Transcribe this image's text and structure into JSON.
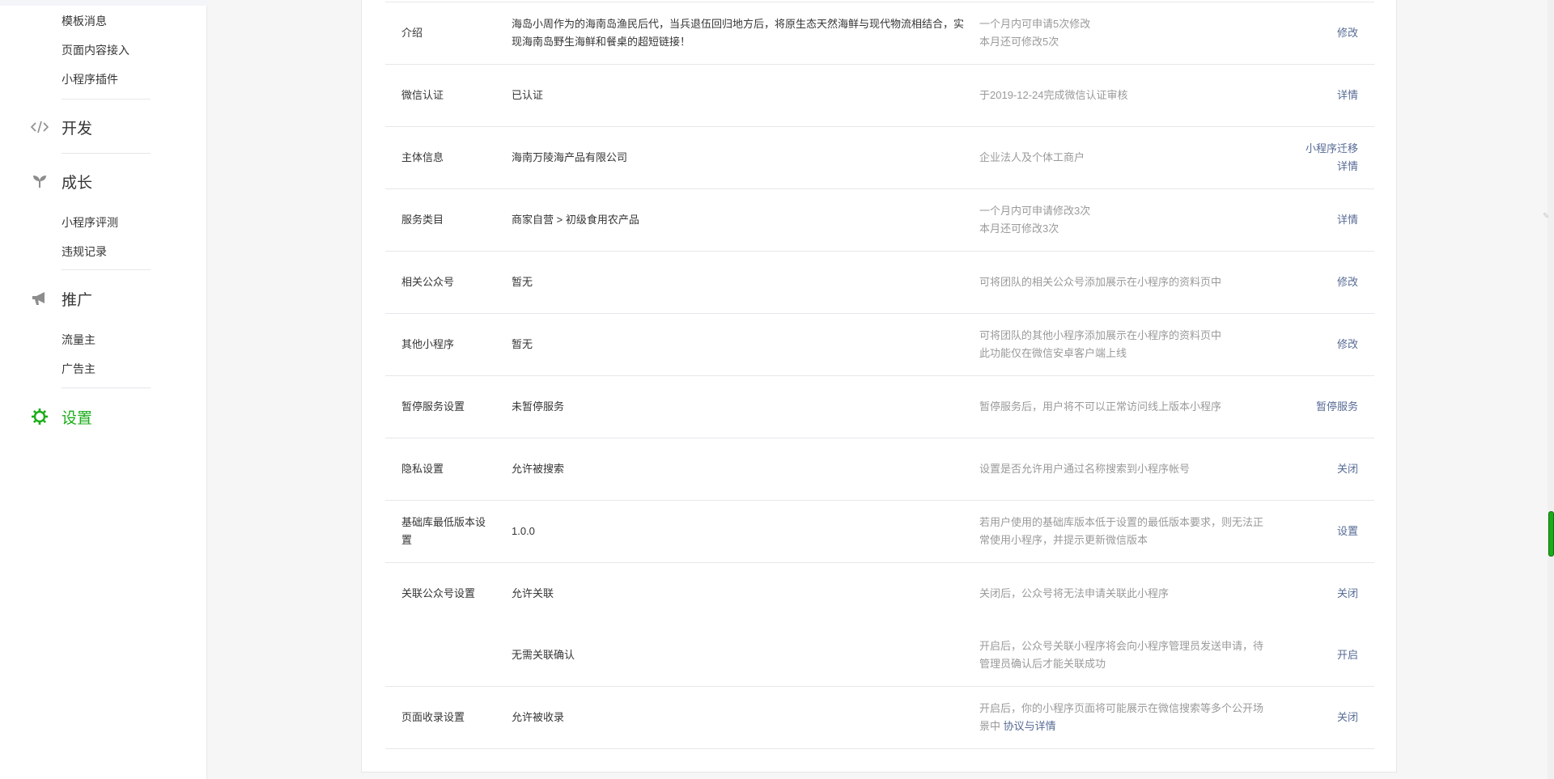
{
  "sidebar": {
    "top_items": [
      "模板消息",
      "页面内容接入",
      "小程序插件"
    ],
    "sections": {
      "dev": {
        "label": "开发",
        "icon": "code-icon"
      },
      "growth": {
        "label": "成长",
        "icon": "sprout-icon",
        "items": [
          "小程序评测",
          "违规记录"
        ]
      },
      "promo": {
        "label": "推广",
        "icon": "megaphone-icon",
        "items": [
          "流量主",
          "广告主"
        ]
      },
      "settings": {
        "label": "设置",
        "icon": "gear-icon",
        "active": true
      }
    },
    "accent_color": "#1aad19"
  },
  "settings_rows": [
    {
      "label": "介绍",
      "value": "海岛小周作为的海南岛渔民后代，当兵退伍回归地方后，将原生态天然海鲜与现代物流相结合，实现海南岛野生海鲜和餐桌的超短链接！",
      "desc": [
        "一个月内可申请5次修改",
        "本月还可修改5次"
      ],
      "actions": [
        "修改"
      ]
    },
    {
      "label": "微信认证",
      "value": "已认证",
      "desc": [
        "于2019-12-24完成微信认证审核"
      ],
      "actions": [
        "详情"
      ]
    },
    {
      "label": "主体信息",
      "value": "海南万陵海产品有限公司",
      "desc": [
        "企业法人及个体工商户"
      ],
      "actions": [
        "小程序迁移",
        "详情"
      ]
    },
    {
      "label": "服务类目",
      "value": "商家自营 > 初级食用农产品",
      "desc": [
        "一个月内可申请修改3次",
        "本月还可修改3次"
      ],
      "actions": [
        "详情"
      ]
    },
    {
      "label": "相关公众号",
      "value": "暂无",
      "desc": [
        "可将团队的相关公众号添加展示在小程序的资料页中"
      ],
      "actions": [
        "修改"
      ]
    },
    {
      "label": "其他小程序",
      "value": "暂无",
      "desc": [
        "可将团队的其他小程序添加展示在小程序的资料页中",
        "此功能仅在微信安卓客户端上线"
      ],
      "actions": [
        "修改"
      ]
    },
    {
      "label": "暂停服务设置",
      "value": "未暂停服务",
      "desc": [
        "暂停服务后，用户将不可以正常访问线上版本小程序"
      ],
      "actions": [
        "暂停服务"
      ]
    },
    {
      "label": "隐私设置",
      "value": "允许被搜索",
      "desc": [
        "设置是否允许用户通过名称搜索到小程序帐号"
      ],
      "actions": [
        "关闭"
      ]
    },
    {
      "label": "基础库最低版本设置",
      "value": "1.0.0",
      "desc": [
        "若用户使用的基础库版本低于设置的最低版本要求，则无法正常使用小程序，并提示更新微信版本"
      ],
      "actions": [
        "设置"
      ]
    },
    {
      "label": "关联公众号设置",
      "value": "允许关联",
      "desc": [
        "关闭后，公众号将无法申请关联此小程序"
      ],
      "actions": [
        "关闭"
      ]
    },
    {
      "label": "",
      "value": "无需关联确认",
      "desc": [
        "开启后，公众号关联小程序将会向小程序管理员发送申请，待管理员确认后才能关联成功"
      ],
      "actions": [
        "开启"
      ]
    },
    {
      "label": "页面收录设置",
      "value": "允许被收录",
      "desc": [
        "开启后，你的小程序页面将可能展示在微信搜索等多个公开场景中"
      ],
      "desc_link": "协议与详情",
      "actions": [
        "关闭"
      ]
    }
  ]
}
